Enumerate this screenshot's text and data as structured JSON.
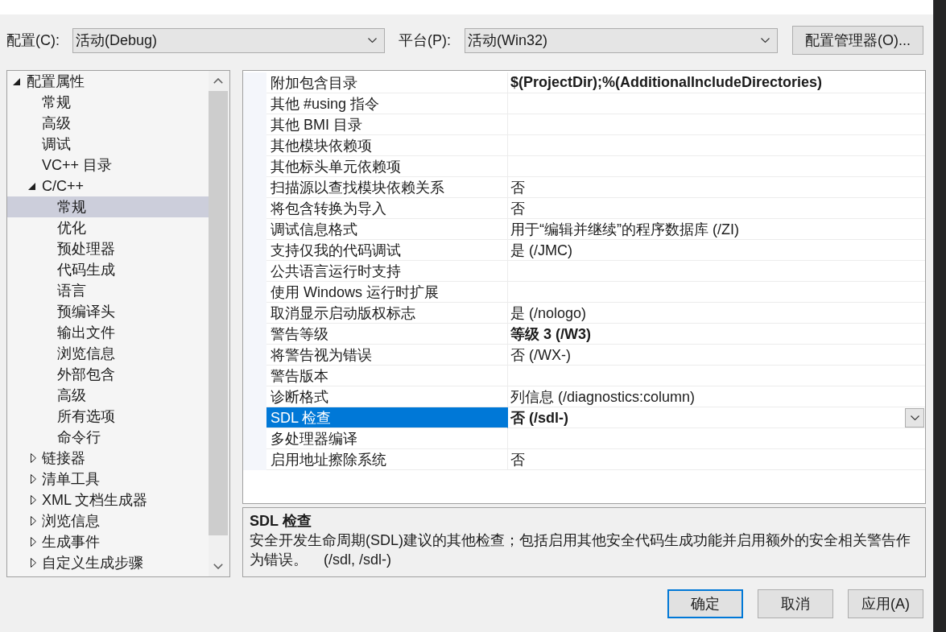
{
  "config_bar": {
    "configuration": {
      "label": "配置(C):",
      "value": "活动(Debug)"
    },
    "platform": {
      "label": "平台(P):",
      "value": "活动(Win32)"
    },
    "manager_button": "配置管理器(O)..."
  },
  "tree": {
    "items": [
      {
        "label": "配置属性",
        "expanded": true,
        "selected": false,
        "children": [
          {
            "label": "常规",
            "selected": false
          },
          {
            "label": "高级",
            "selected": false
          },
          {
            "label": "调试",
            "selected": false
          },
          {
            "label": "VC++ 目录",
            "selected": false
          },
          {
            "label": "C/C++",
            "expanded": true,
            "selected": false,
            "children": [
              {
                "label": "常规",
                "selected": true
              },
              {
                "label": "优化",
                "selected": false
              },
              {
                "label": "预处理器",
                "selected": false
              },
              {
                "label": "代码生成",
                "selected": false
              },
              {
                "label": "语言",
                "selected": false
              },
              {
                "label": "预编译头",
                "selected": false
              },
              {
                "label": "输出文件",
                "selected": false
              },
              {
                "label": "浏览信息",
                "selected": false
              },
              {
                "label": "外部包含",
                "selected": false
              },
              {
                "label": "高级",
                "selected": false
              },
              {
                "label": "所有选项",
                "selected": false
              },
              {
                "label": "命令行",
                "selected": false
              }
            ]
          },
          {
            "label": "链接器",
            "expanded": false,
            "selected": false
          },
          {
            "label": "清单工具",
            "expanded": false,
            "selected": false
          },
          {
            "label": "XML 文档生成器",
            "expanded": false,
            "selected": false
          },
          {
            "label": "浏览信息",
            "expanded": false,
            "selected": false
          },
          {
            "label": "生成事件",
            "expanded": false,
            "selected": false
          },
          {
            "label": "自定义生成步骤",
            "expanded": false,
            "selected": false
          }
        ]
      }
    ]
  },
  "property_grid": {
    "rows": [
      {
        "name": "附加包含目录",
        "value": "$(ProjectDir);%(AdditionalIncludeDirectories)",
        "modified": true,
        "selected": false
      },
      {
        "name": "其他 #using 指令",
        "modified": false,
        "selected": false
      },
      {
        "name": "其他 BMI 目录",
        "modified": false,
        "selected": false
      },
      {
        "name": "其他模块依赖项",
        "modified": false,
        "selected": false
      },
      {
        "name": "其他标头单元依赖项",
        "modified": false,
        "selected": false
      },
      {
        "name": "扫描源以查找模块依赖关系",
        "value": "否",
        "modified": false,
        "selected": false
      },
      {
        "name": "将包含转换为导入",
        "value": "否",
        "modified": false,
        "selected": false
      },
      {
        "name": "调试信息格式",
        "value": "用于“编辑并继续”的程序数据库 (/ZI)",
        "modified": false,
        "selected": false
      },
      {
        "name": "支持仅我的代码调试",
        "value": "是 (/JMC)",
        "modified": false,
        "selected": false
      },
      {
        "name": "公共语言运行时支持",
        "modified": false,
        "selected": false
      },
      {
        "name": "使用 Windows 运行时扩展",
        "modified": false,
        "selected": false
      },
      {
        "name": "取消显示启动版权标志",
        "value": "是 (/nologo)",
        "modified": false,
        "selected": false
      },
      {
        "name": "警告等级",
        "value": "等级 3 (/W3)",
        "modified": true,
        "selected": false
      },
      {
        "name": "将警告视为错误",
        "value": "否 (/WX-)",
        "modified": false,
        "selected": false
      },
      {
        "name": "警告版本",
        "modified": false,
        "selected": false
      },
      {
        "name": "诊断格式",
        "value": "列信息 (/diagnostics:column)",
        "modified": false,
        "selected": false
      },
      {
        "name": "SDL 检查",
        "value": "否 (/sdl-)",
        "modified": true,
        "selected": true
      },
      {
        "name": "多处理器编译",
        "modified": false,
        "selected": false
      },
      {
        "name": "启用地址擦除系统",
        "value": "否",
        "modified": false,
        "selected": false
      }
    ]
  },
  "description": {
    "title": "SDL 检查",
    "text": "安全开发生命周期(SDL)建议的其他检查；包括启用其他安全代码生成功能并启用额外的安全相关警告作为错误。    (/sdl, /sdl-)"
  },
  "buttons": [
    {
      "label": "确定",
      "default": true
    },
    {
      "label": "取消",
      "default": false
    },
    {
      "label": "应用(A)",
      "default": false
    }
  ]
}
